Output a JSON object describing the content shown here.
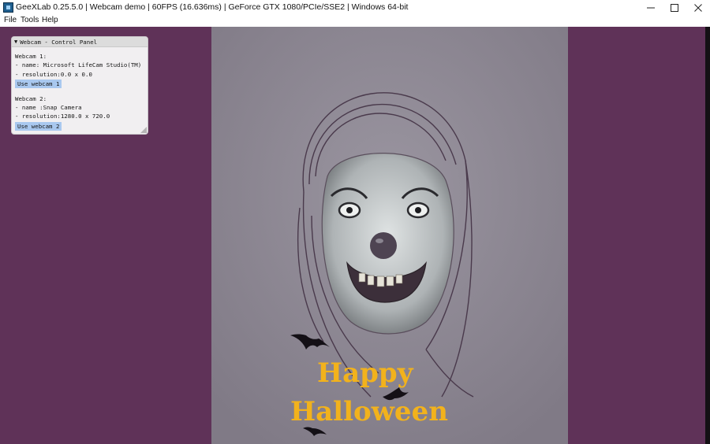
{
  "window": {
    "title": "GeeXLab 0.25.5.0 | Webcam demo | 60FPS (16.636ms) | GeForce GTX 1080/PCIe/SSE2 | Windows 64-bit",
    "app_icon": "geexlab-icon",
    "controls": [
      "minimize-icon",
      "maximize-icon",
      "close-icon"
    ]
  },
  "menu": {
    "file": "File",
    "tools": "Tools",
    "help": "Help"
  },
  "panel": {
    "title": "Webcam - Control Panel",
    "webcam1": {
      "heading": "Webcam 1:",
      "name": "- name: Microsoft LifeCam Studio(TM)",
      "resolution": "- resolution:0.0 x 0.0",
      "button": "Use webcam 1"
    },
    "webcam2": {
      "heading": "Webcam 2:",
      "name": "- name :Snap Camera",
      "resolution": "- resolution:1280.0 x 720.0",
      "button": "Use webcam 2"
    }
  },
  "scene": {
    "greeting_line1": "Happy",
    "greeting_line2": "Halloween"
  },
  "colors": {
    "background": "#5f3258",
    "paper": "#8d8893",
    "text_accent": "#f2b21c",
    "button": "#a9c8ef"
  }
}
